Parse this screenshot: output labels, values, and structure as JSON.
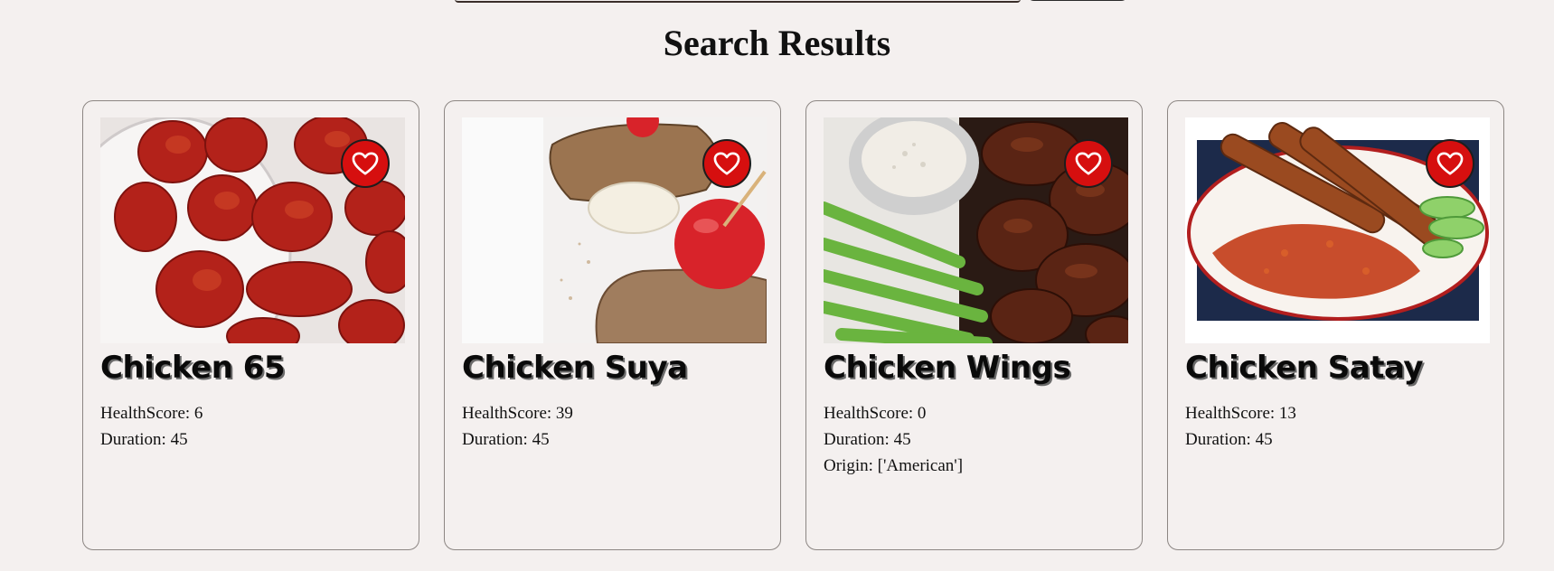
{
  "header": {
    "title": "Search Results"
  },
  "colors": {
    "background": "#f4f0ef",
    "favorite_button": "#d60f0f",
    "card_border": "#8c8683"
  },
  "cards": [
    {
      "title": "Chicken 65",
      "image_icon": "fried-chicken-image",
      "health_label": "HealthScore: 6",
      "duration_label": "Duration: 45",
      "origin_label": ""
    },
    {
      "title": "Chicken Suya",
      "image_icon": "grilled-chicken-image",
      "health_label": "HealthScore: 39",
      "duration_label": "Duration: 45",
      "origin_label": ""
    },
    {
      "title": "Chicken Wings",
      "image_icon": "chicken-wings-image",
      "health_label": "HealthScore: 0",
      "duration_label": "Duration: 45",
      "origin_label": "Origin: ['American']"
    },
    {
      "title": "Chicken Satay",
      "image_icon": "chicken-satay-image",
      "health_label": "HealthScore: 13",
      "duration_label": "Duration: 45",
      "origin_label": ""
    }
  ]
}
